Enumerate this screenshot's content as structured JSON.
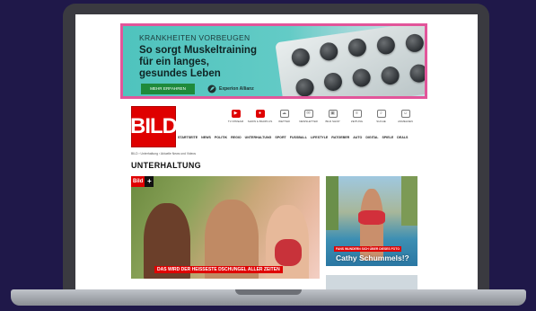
{
  "ad": {
    "kicker": "KRANKHEITEN VORBEUGEN",
    "headline": "So sorgt Muskeltraining\nfür ein langes,\ngesundes Leben",
    "cta": "MEHR ERFAHREN",
    "brand": "Experion Allianz",
    "border_color": "#e2559a"
  },
  "site": {
    "logo": "BILD",
    "brand_color": "#df0000",
    "top_icons": [
      {
        "icon": "tv-icon",
        "label": "TV-STREAM"
      },
      {
        "icon": "bild-live-icon",
        "label": "SHOW & BILDPLUS"
      },
      {
        "icon": "weather-icon",
        "label": "WETTER"
      },
      {
        "icon": "newsletter-icon",
        "label": "NEWSLETTER"
      },
      {
        "icon": "shop-icon",
        "label": "BILD SHOP"
      },
      {
        "icon": "paper-icon",
        "label": "ZEITUNG"
      },
      {
        "icon": "search-icon",
        "label": "SUCHE"
      },
      {
        "icon": "user-icon",
        "label": "ANMELDEN"
      }
    ],
    "nav": [
      "STARTSEITE",
      "NEWS",
      "POLITIK",
      "REGIO",
      "UNTERHALTUNG",
      "SPORT",
      "FUSSBALL",
      "LIFESTYLE",
      "RATGEBER",
      "AUTO",
      "DIGITAL",
      "SPIELE",
      "DEALS"
    ],
    "breadcrumb": "BILD › Unterhaltung › Aktuelle News und Videos",
    "section_title": "UNTERHALTUNG"
  },
  "teasers": {
    "bildplus_label": "Bild",
    "bildplus_plus": "+",
    "main_caption": "DAS WIRD DER HEISSESTE DSCHUNGEL ALLER ZEITEN",
    "side_kicker": "FANS WUNDERN SICH ÜBER DIESES FOTO",
    "side_headline": "Cathy Schummels!?"
  }
}
